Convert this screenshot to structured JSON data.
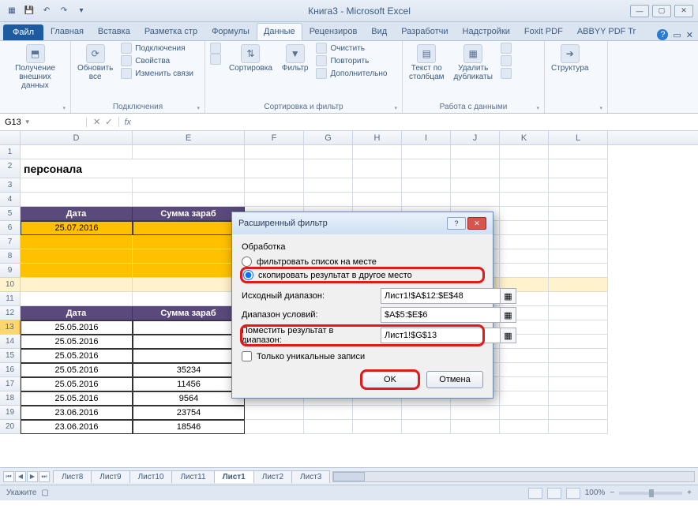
{
  "app_title": "Книга3  -  Microsoft Excel",
  "qat": {
    "save": "💾",
    "undo": "↶",
    "redo": "↷",
    "more": "▾"
  },
  "win": {
    "min": "—",
    "max": "▢",
    "close": "✕"
  },
  "tabs": {
    "file": "Файл",
    "items": [
      "Главная",
      "Вставка",
      "Разметка стр",
      "Формулы",
      "Данные",
      "Рецензиров",
      "Вид",
      "Разработчи",
      "Надстройки",
      "Foxit PDF",
      "ABBYY PDF Tr"
    ],
    "active_index": 4,
    "help": "?"
  },
  "ribbon": {
    "g1": {
      "big": "Получение\nвнешних данных",
      "label": ""
    },
    "g2": {
      "big": "Обновить\nвсе",
      "s1": "Подключения",
      "s2": "Свойства",
      "s3": "Изменить связи",
      "label": "Подключения"
    },
    "g3": {
      "sort": "Сортировка",
      "filter": "Фильтр",
      "s1": "Очистить",
      "s2": "Повторить",
      "s3": "Дополнительно",
      "label": "Сортировка и фильтр"
    },
    "g4": {
      "b1": "Текст по\nстолбцам",
      "b2": "Удалить\nдубликаты",
      "label": "Работа с данными"
    },
    "g5": {
      "big": "Структура",
      "label": ""
    }
  },
  "namebox": "G13",
  "fx": "fx",
  "sheet": {
    "cols": [
      "D",
      "E",
      "F",
      "G",
      "H",
      "I",
      "J",
      "K",
      "L"
    ],
    "row2_text": "персонала",
    "header1": [
      "Дата",
      "Сумма зараб"
    ],
    "row6_date": "25.07.2016",
    "header2": [
      "Дата",
      "Сумма зараб"
    ],
    "data": [
      [
        "25.05.2016",
        ""
      ],
      [
        "25.05.2016",
        ""
      ],
      [
        "25.05.2016",
        ""
      ],
      [
        "25.05.2016",
        "35234"
      ],
      [
        "25.05.2016",
        "11456"
      ],
      [
        "25.05.2016",
        "9564"
      ],
      [
        "23.06.2016",
        "23754"
      ],
      [
        "23.06.2016",
        "18546"
      ]
    ]
  },
  "sheet_tabs": [
    "Лист8",
    "Лист9",
    "Лист10",
    "Лист11",
    "Лист1",
    "Лист2",
    "Лист3"
  ],
  "sheet_active": 4,
  "status": {
    "text": "Укажите",
    "zoom": "100%"
  },
  "dialog": {
    "title": "Расширенный фильтр",
    "group_label": "Обработка",
    "radio1": "фильтровать список на месте",
    "radio2": "скопировать результат в другое место",
    "f1_label": "Исходный диапазон:",
    "f1_value": "Лист1!$A$12:$E$48",
    "f2_label": "Диапазон условий:",
    "f2_value": "$A$5:$E$6",
    "f3_label": "Поместить результат в диапазон:",
    "f3_value": "Лист1!$G$13",
    "check": "Только уникальные записи",
    "ok": "OK",
    "cancel": "Отмена"
  },
  "chart_data": {
    "type": "table",
    "note": "screenshot of Excel worksheet, no chart — tabular data only",
    "table": [
      {
        "Дата": "25.05.2016",
        "Сумма зараб": 35234
      },
      {
        "Дата": "25.05.2016",
        "Сумма зараб": 11456
      },
      {
        "Дата": "25.05.2016",
        "Сумма зараб": 9564
      },
      {
        "Дата": "23.06.2016",
        "Сумма зараб": 23754
      },
      {
        "Дата": "23.06.2016",
        "Сумма зараб": 18546
      }
    ]
  }
}
